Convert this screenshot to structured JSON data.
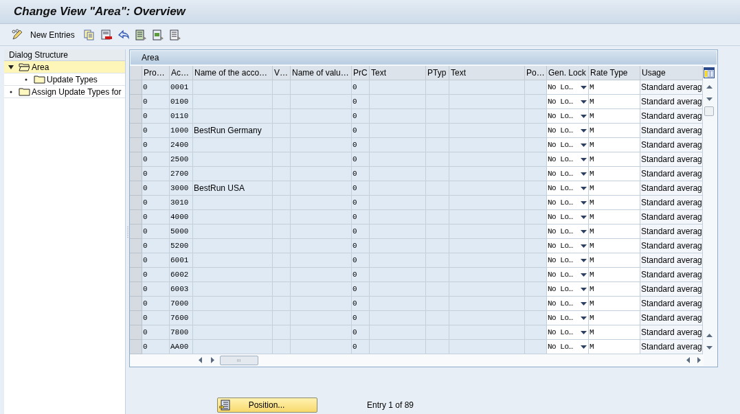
{
  "window": {
    "title": "Change View \"Area\": Overview"
  },
  "toolbar": {
    "buttons": [
      {
        "kind": "edit",
        "label": "New Entries"
      },
      {
        "kind": "copy"
      },
      {
        "kind": "delete"
      },
      {
        "kind": "undo"
      },
      {
        "kind": "select_all"
      },
      {
        "kind": "select_block"
      },
      {
        "kind": "deselect_all"
      }
    ]
  },
  "dialog_structure": {
    "title": "Dialog Structure",
    "items": [
      {
        "label": "Area",
        "expanded": true,
        "selected": true,
        "children": [
          {
            "label": "Update Types",
            "selected": false
          }
        ]
      },
      {
        "label": "Assign Update Types for",
        "expanded": false,
        "selected": false
      }
    ]
  },
  "table": {
    "title": "Area",
    "columns": [
      "Pro…",
      "Ac…",
      "Name of the acco…",
      "V…",
      "Name of valu…",
      "PrC",
      "Text",
      "PTyp",
      "Text",
      "Po…",
      "Gen. Lock",
      "Rate Type",
      "Usage"
    ],
    "rows": [
      {
        "pro": "0",
        "acc": "0001",
        "prc": "0",
        "gen_lock": "No Lo…",
        "rate": "M",
        "usage": "Standard averag"
      },
      {
        "pro": "0",
        "acc": "0100",
        "prc": "0",
        "gen_lock": "No Lo…",
        "rate": "M",
        "usage": "Standard averag"
      },
      {
        "pro": "0",
        "acc": "0110",
        "prc": "0",
        "gen_lock": "No Lo…",
        "rate": "M",
        "usage": "Standard averag"
      },
      {
        "pro": "0",
        "acc": "1000",
        "name": "BestRun Germany",
        "prc": "0",
        "gen_lock": "No Lo…",
        "rate": "M",
        "usage": "Standard averag"
      },
      {
        "pro": "0",
        "acc": "2400",
        "prc": "0",
        "gen_lock": "No Lo…",
        "rate": "M",
        "usage": "Standard averag"
      },
      {
        "pro": "0",
        "acc": "2500",
        "prc": "0",
        "gen_lock": "No Lo…",
        "rate": "M",
        "usage": "Standard averag"
      },
      {
        "pro": "0",
        "acc": "2700",
        "prc": "0",
        "gen_lock": "No Lo…",
        "rate": "M",
        "usage": "Standard averag"
      },
      {
        "pro": "0",
        "acc": "3000",
        "name": "BestRun USA",
        "prc": "0",
        "gen_lock": "No Lo…",
        "rate": "M",
        "usage": "Standard averag"
      },
      {
        "pro": "0",
        "acc": "3010",
        "prc": "0",
        "gen_lock": "No Lo…",
        "rate": "M",
        "usage": "Standard averag"
      },
      {
        "pro": "0",
        "acc": "4000",
        "prc": "0",
        "gen_lock": "No Lo…",
        "rate": "M",
        "usage": "Standard averag"
      },
      {
        "pro": "0",
        "acc": "5000",
        "prc": "0",
        "gen_lock": "No Lo…",
        "rate": "M",
        "usage": "Standard averag"
      },
      {
        "pro": "0",
        "acc": "5200",
        "prc": "0",
        "gen_lock": "No Lo…",
        "rate": "M",
        "usage": "Standard averag"
      },
      {
        "pro": "0",
        "acc": "6001",
        "prc": "0",
        "gen_lock": "No Lo…",
        "rate": "M",
        "usage": "Standard averag"
      },
      {
        "pro": "0",
        "acc": "6002",
        "prc": "0",
        "gen_lock": "No Lo…",
        "rate": "M",
        "usage": "Standard averag"
      },
      {
        "pro": "0",
        "acc": "6003",
        "prc": "0",
        "gen_lock": "No Lo…",
        "rate": "M",
        "usage": "Standard averag"
      },
      {
        "pro": "0",
        "acc": "7000",
        "prc": "0",
        "gen_lock": "No Lo…",
        "rate": "M",
        "usage": "Standard averag"
      },
      {
        "pro": "0",
        "acc": "7600",
        "prc": "0",
        "gen_lock": "No Lo…",
        "rate": "M",
        "usage": "Standard averag"
      },
      {
        "pro": "0",
        "acc": "7800",
        "prc": "0",
        "gen_lock": "No Lo…",
        "rate": "M",
        "usage": "Standard averag"
      },
      {
        "pro": "0",
        "acc": "AA00",
        "prc": "0",
        "gen_lock": "No Lo…",
        "rate": "M",
        "usage": "Standard averag"
      }
    ]
  },
  "footer": {
    "position_button": "Position...",
    "entry_info": "Entry 1 of 89"
  }
}
